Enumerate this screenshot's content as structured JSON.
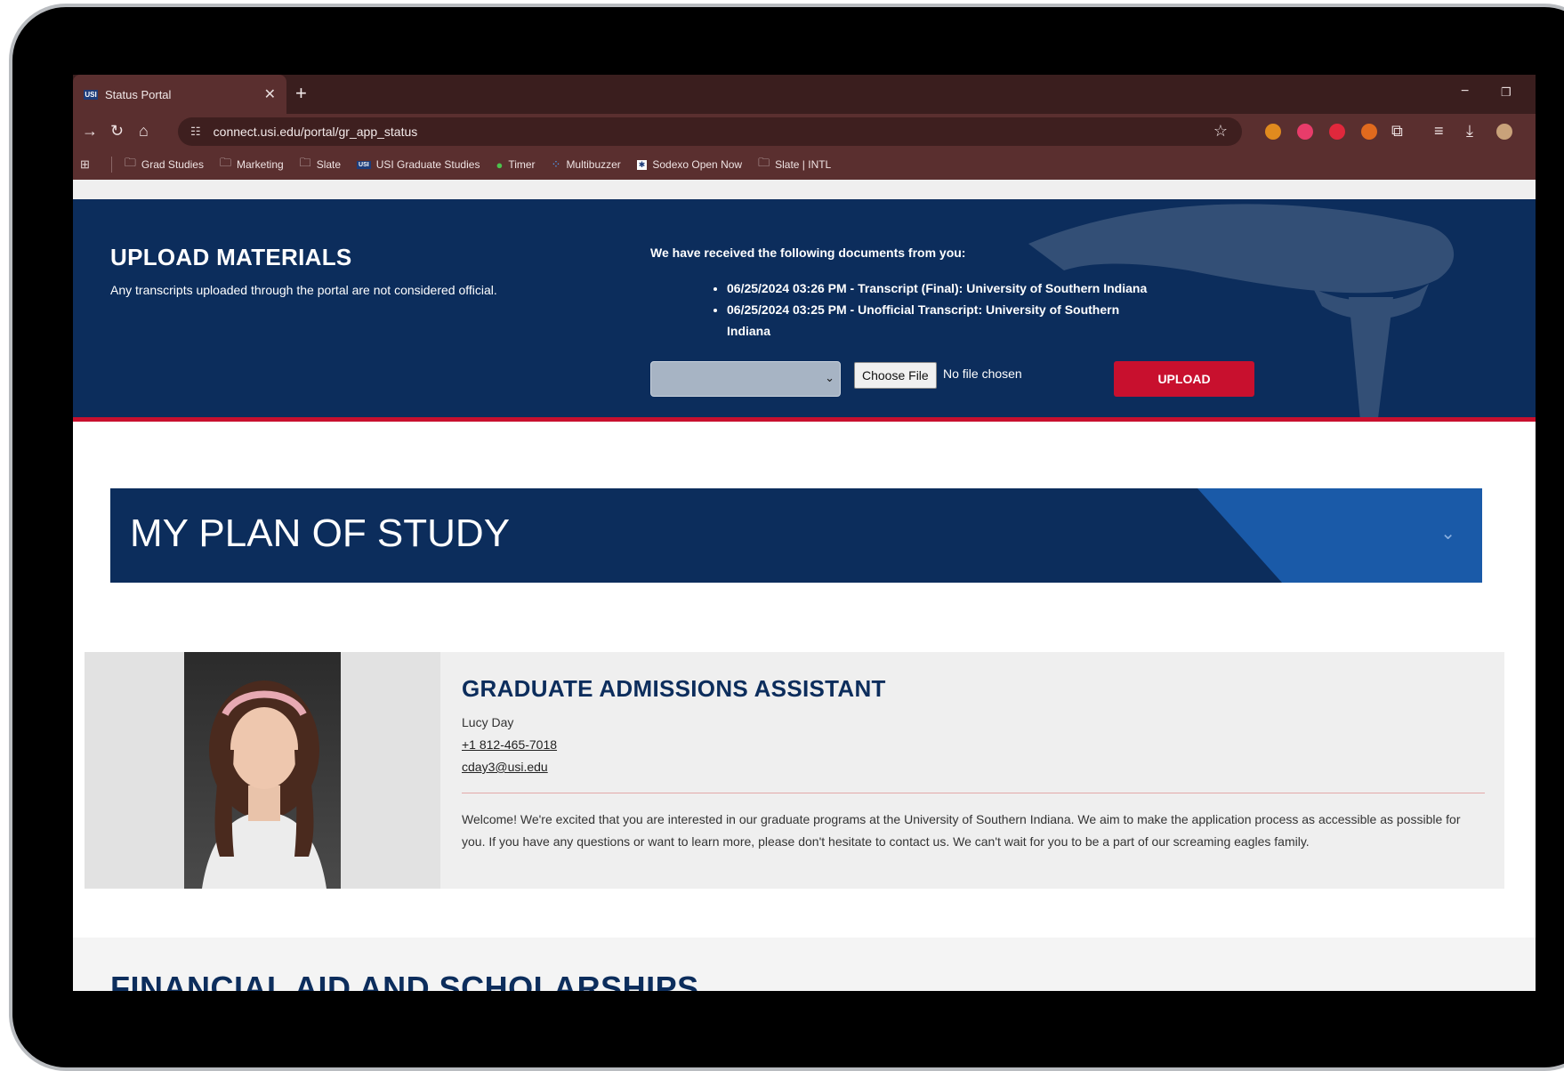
{
  "browser": {
    "tab_title": "Status Portal",
    "tab_favicon_text": "USI",
    "new_tab_glyph": "+",
    "close_glyph": "✕",
    "url": "connect.usi.edu/portal/gr_app_status",
    "minimize_glyph": "−",
    "restore_glyph": "❐"
  },
  "bookmarks": [
    {
      "label": "Grad Studies",
      "icon": "folder-icon"
    },
    {
      "label": "Marketing",
      "icon": "folder-icon"
    },
    {
      "label": "Slate",
      "icon": "folder-icon"
    },
    {
      "label": "USI Graduate Studies",
      "icon": "usi-logo-icon"
    },
    {
      "label": "Timer",
      "icon": "tree-icon"
    },
    {
      "label": "Multibuzzer",
      "icon": "dots-icon"
    },
    {
      "label": "Sodexo Open Now",
      "icon": "sodexo-icon"
    },
    {
      "label": "Slate | INTL",
      "icon": "folder-icon"
    }
  ],
  "upload": {
    "title": "UPLOAD MATERIALS",
    "note": "Any transcripts uploaded through the portal are not considered official.",
    "docs_heading": "We have received the following documents from you:",
    "documents": [
      "06/25/2024 03:26 PM - Transcript (Final): University of Southern Indiana",
      "06/25/2024 03:25 PM - Unofficial Transcript: University of Southern Indiana"
    ],
    "select_value": "",
    "choose_file_label": "Choose File",
    "no_file_text": "No file chosen",
    "upload_label": "UPLOAD"
  },
  "plan": {
    "title": "MY PLAN OF STUDY"
  },
  "staff": {
    "role": "GRADUATE ADMISSIONS ASSISTANT",
    "name": "Lucy Day",
    "phone": "+1 812-465-7018",
    "email": "cday3@usi.edu",
    "welcome": "Welcome! We're excited that you are interested in our graduate programs at the University of Southern Indiana. We aim to make the application process as accessible as possible for you. If you have any questions or want to learn more, please don't hesitate to contact us. We can't wait for you to be a part of our screaming eagles family."
  },
  "financial_aid": {
    "title": "FINANCIAL AID AND SCHOLARSHIPS"
  },
  "colors": {
    "navy": "#0c2d5c",
    "red": "#c8102e",
    "chrome": "#5a2f2f"
  }
}
